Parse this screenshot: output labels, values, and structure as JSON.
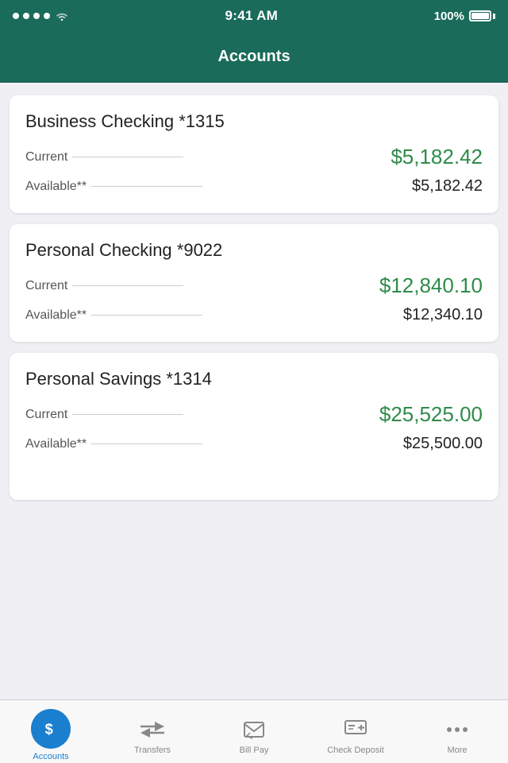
{
  "statusBar": {
    "time": "9:41 AM",
    "battery": "100%"
  },
  "header": {
    "title": "Accounts"
  },
  "accounts": [
    {
      "name": "Business Checking *1315",
      "current": "$5,182.42",
      "available": "$5,182.42"
    },
    {
      "name": "Personal Checking *9022",
      "current": "$12,840.10",
      "available": "$12,340.10"
    },
    {
      "name": "Personal Savings *1314",
      "current": "$25,525.00",
      "available": "$25,500.00"
    }
  ],
  "labels": {
    "current": "Current",
    "available": "Available**"
  },
  "tabBar": {
    "items": [
      {
        "id": "accounts",
        "label": "Accounts",
        "active": true
      },
      {
        "id": "transfers",
        "label": "Transfers",
        "active": false
      },
      {
        "id": "bill-pay",
        "label": "Bill Pay",
        "active": false
      },
      {
        "id": "check-deposit",
        "label": "Check Deposit",
        "active": false
      },
      {
        "id": "more",
        "label": "More",
        "active": false
      }
    ]
  }
}
